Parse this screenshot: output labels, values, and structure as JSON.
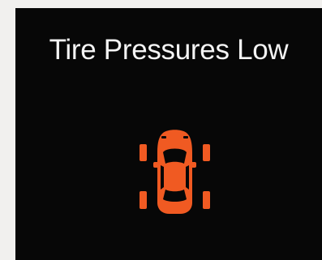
{
  "warning": {
    "title": "Tire Pressures Low",
    "icon": "car-top-view-tire-pressure-icon",
    "icon_color": "#f05a22"
  },
  "colors": {
    "background": "#070707",
    "frame": "#f1f0ee",
    "text": "#f4f4f4",
    "accent": "#f05a22"
  }
}
